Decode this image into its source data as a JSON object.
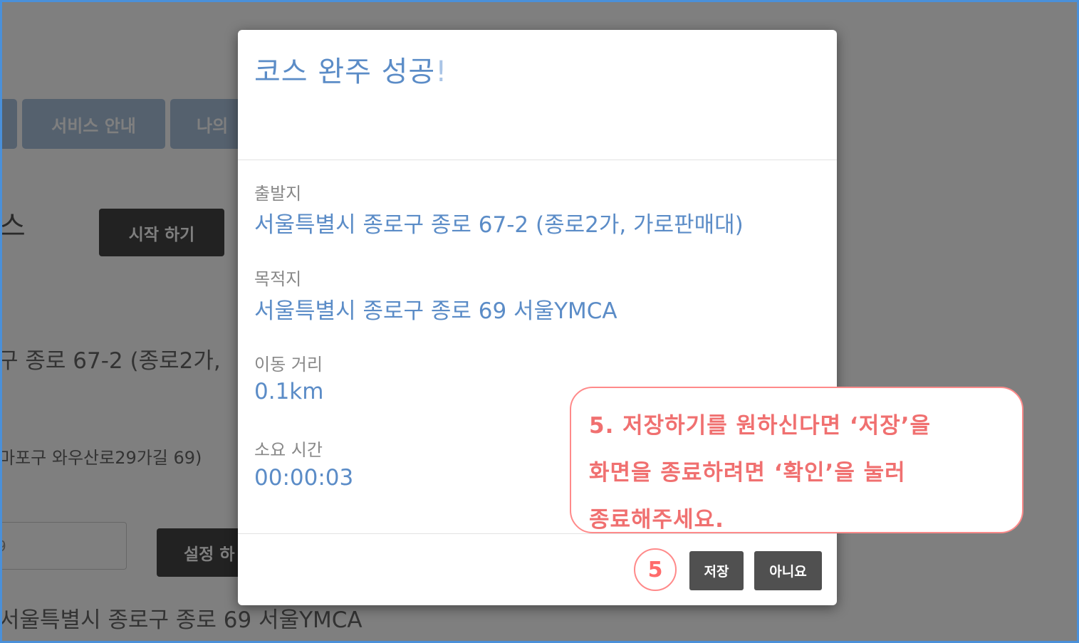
{
  "background": {
    "tabs": [
      "서비스 안내",
      "나의"
    ],
    "section_heading_fragment": "스",
    "start_button": "시작 하기",
    "start_address_fragment": "구 종로 67-2 (종로2가,",
    "mapo_address_fragment": "마포구 와우산로29가길 69)",
    "input_value_fragment": "9",
    "set_button_fragment": "설정 하",
    "dest_address_fragment": "서울특별시 종로구 종로 69 서울YMCA"
  },
  "modal": {
    "title": "코스 완주 성공",
    "title_suffix": "!",
    "fields": [
      {
        "label": "출발지",
        "value": "서울특별시 종로구 종로 67-2 (종로2가, 가로판매대)"
      },
      {
        "label": "목적지",
        "value": "서울특별시 종로구 종로 69 서울YMCA"
      },
      {
        "label": "이동 거리",
        "value": "0.1km"
      },
      {
        "label": "소요 시간",
        "value": "00:00:03"
      }
    ],
    "save_button": "저장",
    "no_button": "아니요"
  },
  "annotation": {
    "step_number": "5",
    "lines": [
      "5. 저장하기를 원하신다면 ‘저장’을",
      "화면을 종료하려면 ‘확인’을 눌러",
      "종료해주세요."
    ]
  },
  "colors": {
    "frame_border": "#4a90d9",
    "modal_accent": "#5b8cc7",
    "annotation_red": "#f07070"
  }
}
